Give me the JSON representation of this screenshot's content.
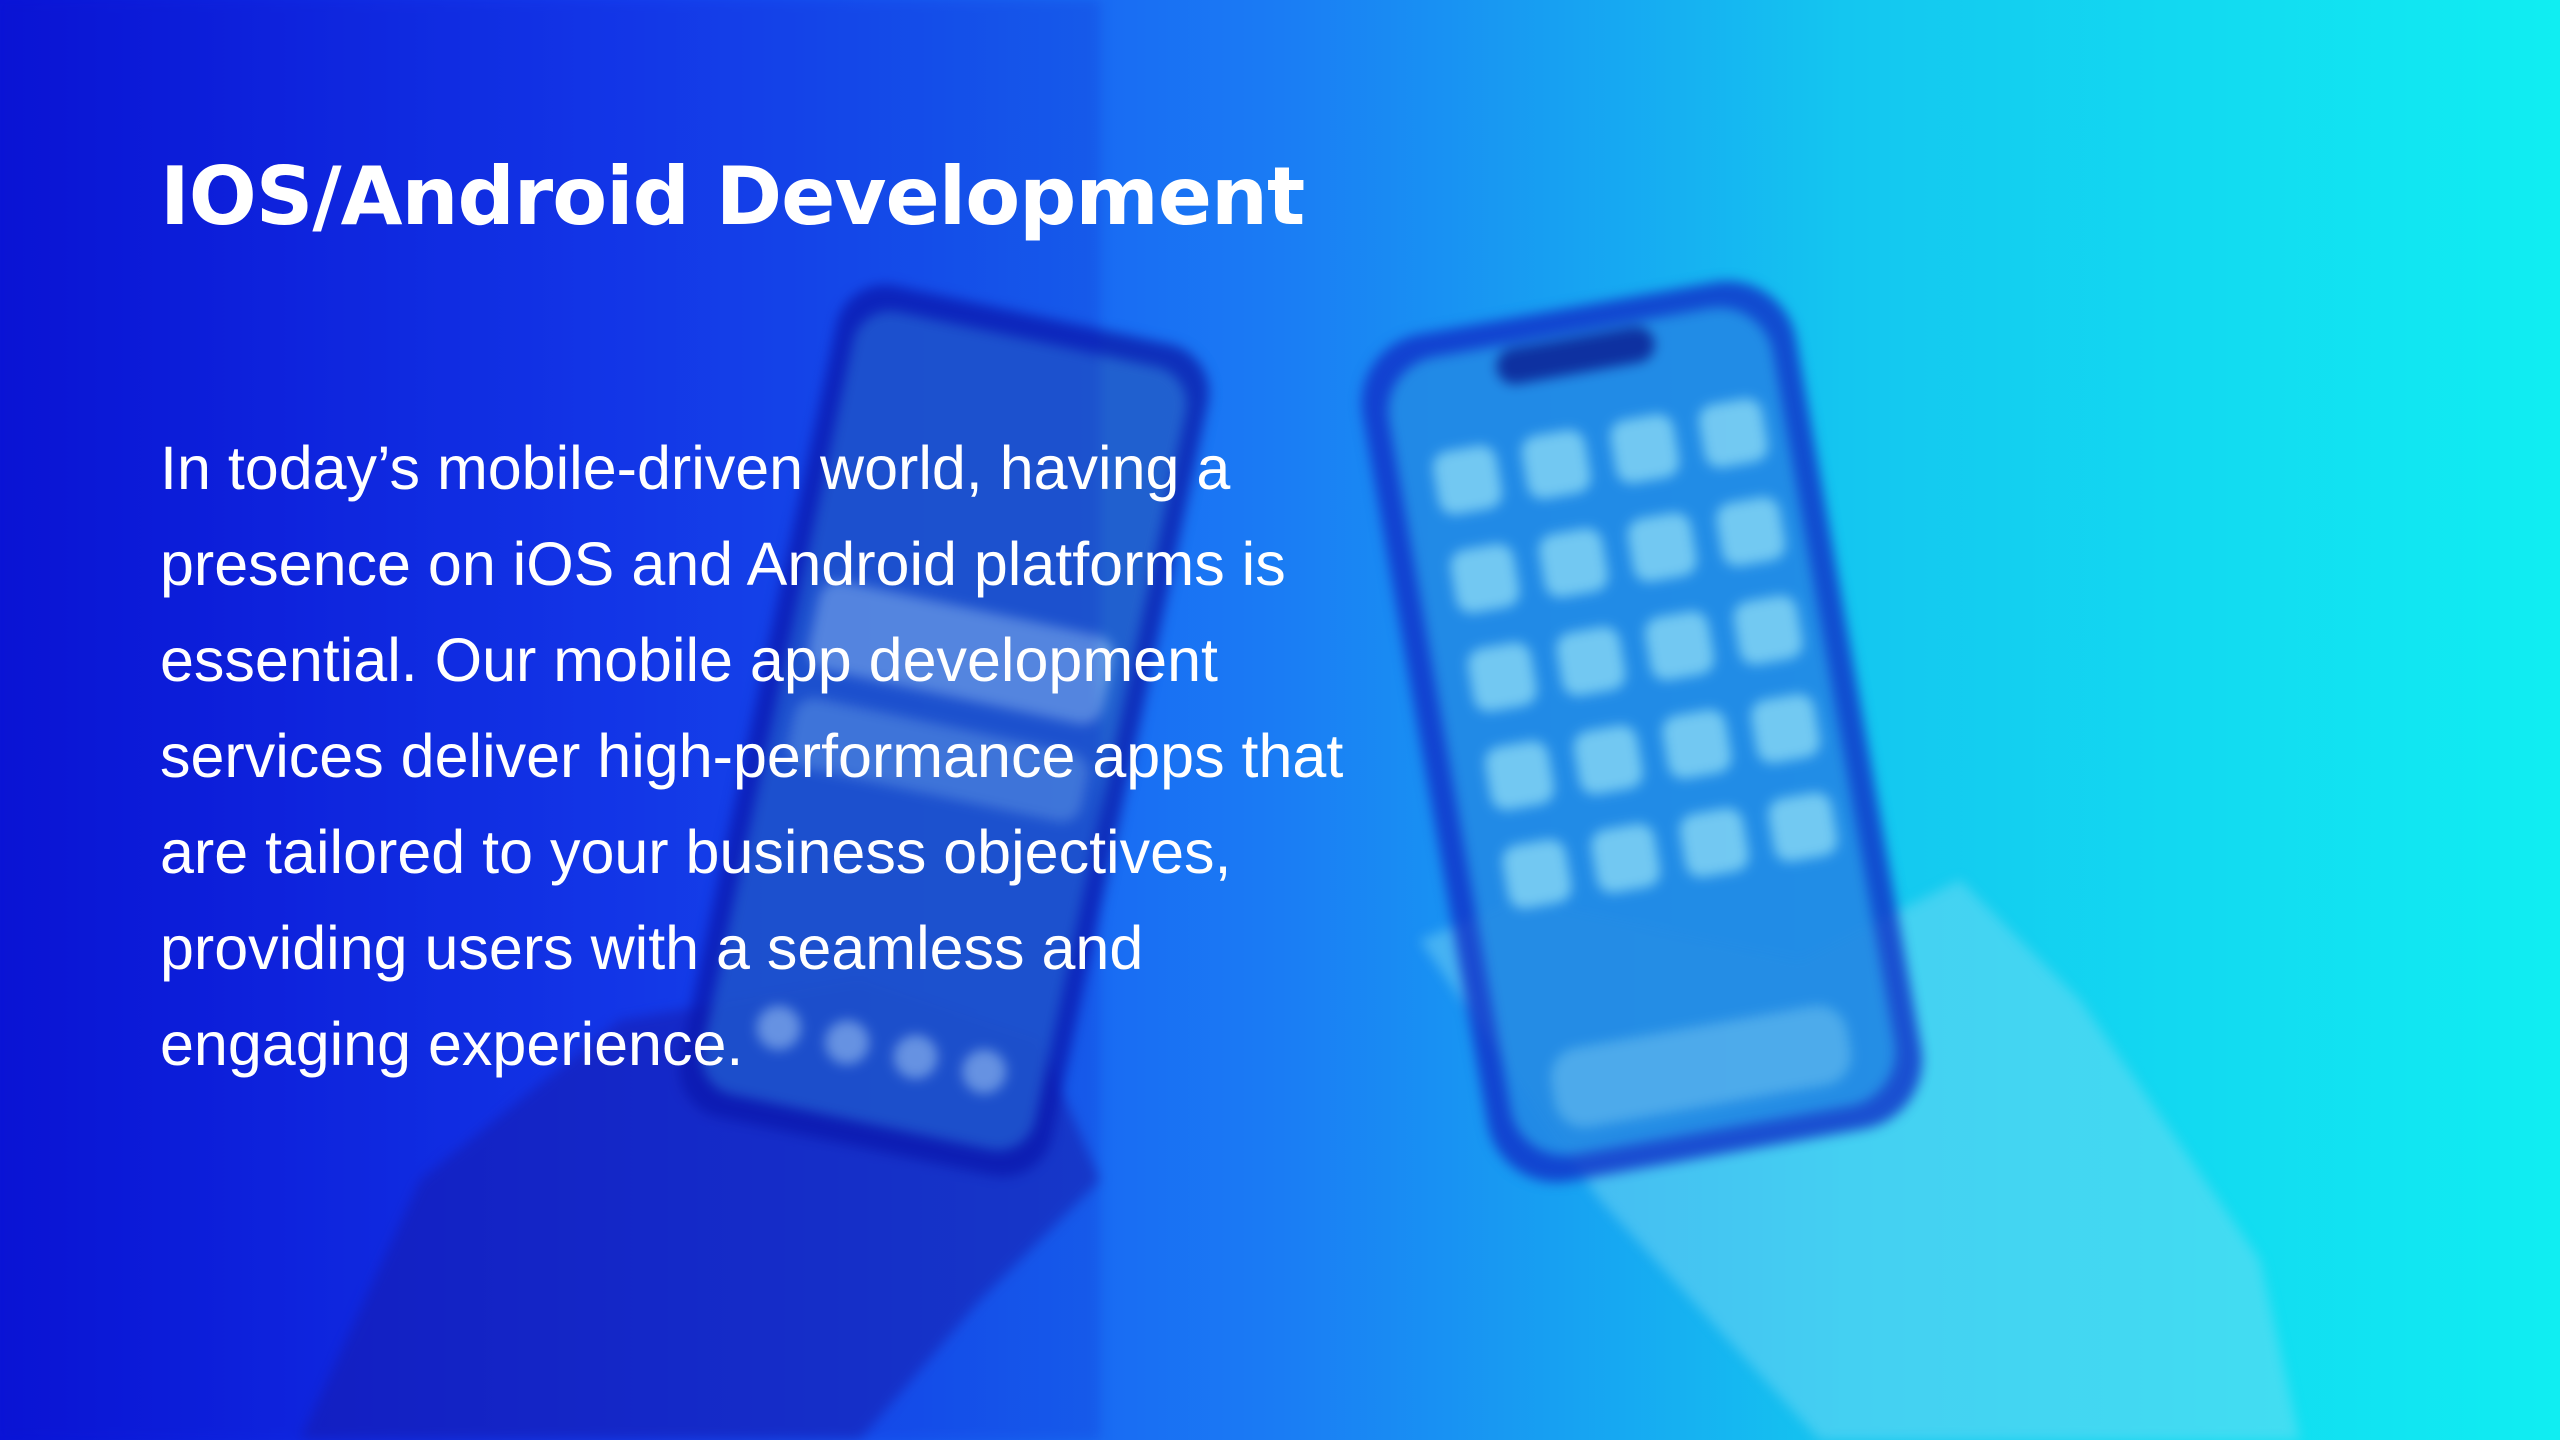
{
  "slide": {
    "title": "IOS/Android Development",
    "paragraph_lines": [
      "In today’s mobile-driven world, having a",
      "presence on iOS and Android platforms is",
      "essential. Our mobile app development",
      "services deliver high-performance apps that",
      "are tailored to your business objectives,",
      "providing users with a seamless and",
      "engaging experience."
    ]
  },
  "colors": {
    "gradient_start": "#0a14d8",
    "gradient_end": "#10eef2",
    "text": "#ffffff"
  }
}
